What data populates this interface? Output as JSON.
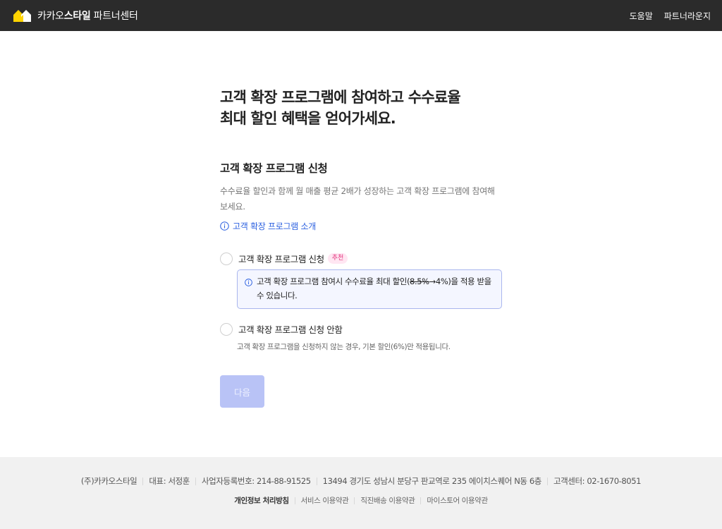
{
  "header": {
    "logo_icon": "kakao-style-house-icon",
    "logo_brand_prefix": "카카오",
    "logo_brand_bold": "스타일",
    "logo_suffix": " 파트너센터",
    "nav": [
      "도움말",
      "파트너라운지"
    ]
  },
  "main": {
    "headline_line1": "고객 확장 프로그램에 참여하고 수수료율",
    "headline_line2": "최대 할인 혜택을 얻어가세요.",
    "section_title": "고객 확장 프로그램 신청",
    "description": "수수료율 할인과 함께 월 매출 평균 2배가 성장하는 고객 확장 프로그램에 참여해보세요.",
    "intro_link": "고객 확장 프로그램 소개",
    "option_apply": {
      "label": "고객 확장 프로그램 신청",
      "badge": "추천",
      "selected": false,
      "notice_before": "고객 확장 프로그램 참여시 수수료율 최대 할인(",
      "notice_strike": "8.5%",
      "notice_after": "→4%)을 적용 받을 수 있습니다."
    },
    "option_decline": {
      "label": "고객 확장 프로그램 신청 안함",
      "selected": false,
      "sub_description": "고객 확장 프로그램을 신청하지 않는 경우, 기본 할인(6%)만 적용됩니다."
    },
    "next_button": "다음"
  },
  "footer": {
    "company_info": [
      "(주)카카오스타일",
      "대표: 서정훈",
      "사업자등록번호: 214-88-91525",
      "13494 경기도 성남시 분당구 판교역로 235 에이치스퀘어 N동 6층",
      "고객센터: 02-1670-8051"
    ],
    "links": [
      "개인정보 처리방침",
      "서비스 이용약관",
      "직진배송 이용약관",
      "마이스토어 이용약관"
    ]
  },
  "colors": {
    "header_bg": "#2b2b2b",
    "logo_yellow": "#ffd400",
    "link_blue": "#2e62e0",
    "badge_pink": "#e2327b",
    "notice_border": "#a9b6ee",
    "button_disabled": "#b9c3f6",
    "footer_bg": "#f1f1f1"
  }
}
